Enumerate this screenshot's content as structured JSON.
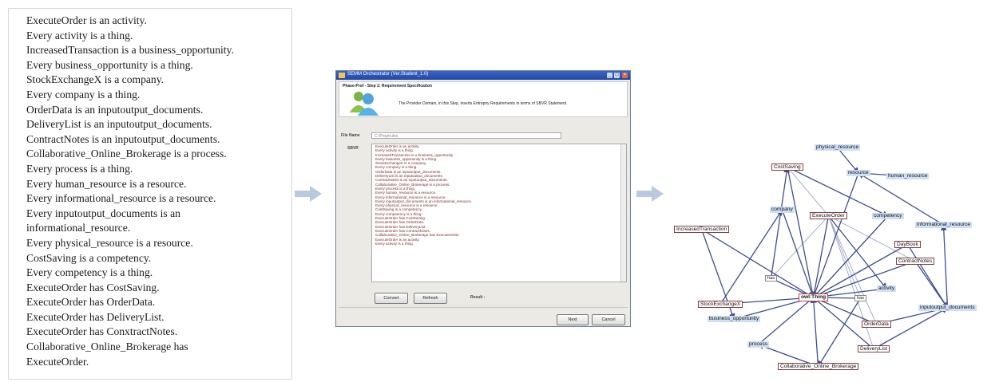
{
  "text_panel": {
    "lines": [
      "ExecuteOrder is an activity.",
      "Every activity is a thing.",
      "IncreasedTransaction is a business_opportunity.",
      "Every business_opportunity is a thing.",
      "StockExchangeX is a company.",
      "Every company is a thing.",
      "OrderData is an inputoutput_documents.",
      "DeliveryList is an inputoutput_documents.",
      "ContractNotes is an inputoutput_documents.",
      "Collaborative_Online_Brokerage is a process.",
      "Every process is a thing.",
      "Every human_resource is a resource.",
      "Every informational_resource is a resource.",
      "Every inputoutput_documents is an",
      "informational_resource.",
      "Every physical_resource is a resource.",
      "CostSaving is a competency.",
      "Every competency is a thing.",
      "ExecuteOrder has CostSaving.",
      "ExecuteOrder has OrderData.",
      "ExecuteOrder has DeliveryList.",
      "ExecuteOrder has ConxtractNotes.",
      "Collaborative_Online_Brokerage has",
      "ExecuteOrder."
    ]
  },
  "arrow_color": "#b9c9df",
  "window": {
    "title": "SEMM Orchestrator (Ver.Student_1.0)",
    "phase": "Phase-Prof - Step 2: Requirement Specification",
    "instruction": "The Provider Domain, in this Step, inserts Entrepriy Requirements in terms of SBVR Statement.",
    "file_label": "File Name",
    "file_value": "C:\\Prog\\rules",
    "rules_label": "SBVR",
    "list_rows": [
      "ExecuteOrder is an activity.",
      "Every activity is a thing.",
      "IncreasedTransaction is a business_opportunity.",
      "Every business_opportunity is a thing.",
      "StockExchangeX is a company.",
      "Every company is a thing.",
      "OrderData is an inputoutput_documents.",
      "DeliveryList is an inputoutput_documents.",
      "ContractNotes is an inputoutput_documents.",
      "Collaborative_Online_Brokerage is a process.",
      "Every process is a thing.",
      "Every human_resource is a resource.",
      "Every informational_resource is a resource.",
      "Every inputoutput_documents is an informational_resource.",
      "Every physical_resource is a resource.",
      "CostSaving is a competency.",
      "Every competency is a thing.",
      "ExecuteOrder has CostSaving.",
      "ExecuteOrder has OrderData.",
      "ExecuteOrder has DeliveryList.",
      "ExecuteOrder has ContractNotes.",
      "Collaborative_Online_Brokerage has ExecuteOrder.",
      "ExecuteOrder is an activity.",
      "Every activity is a thing."
    ],
    "buttons": {
      "convert": "Convert",
      "refresh": "Refresh",
      "next": "Next",
      "cancel": "Cancel"
    },
    "result_label": "Result :"
  },
  "graph": {
    "nodes": [
      {
        "id": "physical_resource",
        "label": "physical_resource",
        "kind": "concept"
      },
      {
        "id": "resource",
        "label": "resource",
        "kind": "concept"
      },
      {
        "id": "human_resource",
        "label": "human_resource",
        "kind": "concept"
      },
      {
        "id": "CostSaving",
        "label": "CostSaving",
        "kind": "inst"
      },
      {
        "id": "company",
        "label": "company",
        "kind": "concept"
      },
      {
        "id": "ExecuteOrder",
        "label": "ExecuteOrder",
        "kind": "inst"
      },
      {
        "id": "competency",
        "label": "competency",
        "kind": "concept"
      },
      {
        "id": "informational_resource",
        "label": "informational_resource",
        "kind": "concept"
      },
      {
        "id": "IncreasedTransaction",
        "label": "IncreasedTransaction",
        "kind": "inst"
      },
      {
        "id": "DayBook",
        "label": "DayBook",
        "kind": "inst"
      },
      {
        "id": "ContractNotes",
        "label": "ContractNotes",
        "kind": "inst"
      },
      {
        "id": "has1",
        "label": "has",
        "kind": "rel"
      },
      {
        "id": "owlThing",
        "label": "owl:Thing",
        "kind": "owl"
      },
      {
        "id": "StockExchangeX",
        "label": "StockExchangeX",
        "kind": "inst"
      },
      {
        "id": "activity",
        "label": "activity",
        "kind": "concept"
      },
      {
        "id": "has2",
        "label": "has",
        "kind": "rel"
      },
      {
        "id": "inputoutput_documents",
        "label": "inputoutput_documents",
        "kind": "concept"
      },
      {
        "id": "business_opportunity",
        "label": "business_opportunity",
        "kind": "concept"
      },
      {
        "id": "OrderData",
        "label": "OrderData",
        "kind": "inst"
      },
      {
        "id": "process",
        "label": "process",
        "kind": "concept"
      },
      {
        "id": "DeliveryList",
        "label": "DeliveryList",
        "kind": "inst"
      },
      {
        "id": "Collaborative_Online_Brokerage",
        "label": "Collaborative_Online_Brokerage",
        "kind": "inst"
      }
    ],
    "edges": [
      [
        "physical_resource",
        "resource"
      ],
      [
        "human_resource",
        "resource"
      ],
      [
        "informational_resource",
        "resource"
      ],
      [
        "resource",
        "owlThing"
      ],
      [
        "competency",
        "owlThing"
      ],
      [
        "company",
        "owlThing"
      ],
      [
        "activity",
        "owlThing"
      ],
      [
        "process",
        "owlThing"
      ],
      [
        "business_opportunity",
        "owlThing"
      ],
      [
        "inputoutput_documents",
        "informational_resource"
      ],
      [
        "CostSaving",
        "competency"
      ],
      [
        "ExecuteOrder",
        "activity"
      ],
      [
        "StockExchangeX",
        "company"
      ],
      [
        "IncreasedTransaction",
        "business_opportunity"
      ],
      [
        "Collaborative_Online_Brokerage",
        "process"
      ],
      [
        "OrderData",
        "inputoutput_documents"
      ],
      [
        "DeliveryList",
        "inputoutput_documents"
      ],
      [
        "ContractNotes",
        "inputoutput_documents"
      ],
      [
        "DayBook",
        "inputoutput_documents"
      ],
      [
        "CostSaving",
        "owlThing"
      ],
      [
        "ExecuteOrder",
        "owlThing"
      ],
      [
        "StockExchangeX",
        "owlThing"
      ],
      [
        "IncreasedTransaction",
        "owlThing"
      ],
      [
        "OrderData",
        "owlThing"
      ],
      [
        "DeliveryList",
        "owlThing"
      ],
      [
        "ContractNotes",
        "owlThing"
      ],
      [
        "DayBook",
        "owlThing"
      ],
      [
        "Collaborative_Online_Brokerage",
        "owlThing"
      ],
      [
        "has1",
        "owlThing"
      ],
      [
        "has2",
        "owlThing"
      ],
      [
        "has1",
        "CostSaving"
      ],
      [
        "has2",
        "Collaborative_Online_Brokerage"
      ]
    ],
    "lines": [
      [
        "ExecuteOrder",
        "has1"
      ],
      [
        "ExecuteOrder",
        "has2"
      ],
      [
        "ExecuteOrder",
        "CostSaving"
      ],
      [
        "ExecuteOrder",
        "OrderData"
      ],
      [
        "ExecuteOrder",
        "DeliveryList"
      ],
      [
        "ExecuteOrder",
        "ContractNotes"
      ]
    ],
    "edge_color": "#3d4f8f",
    "line_color": "#9aa6c8"
  }
}
